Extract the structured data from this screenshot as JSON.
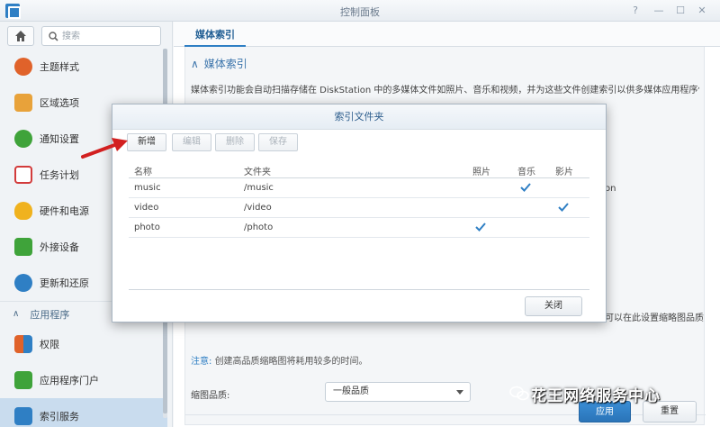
{
  "window": {
    "title": "控制面板"
  },
  "search": {
    "placeholder": "搜索"
  },
  "sidebar": {
    "items": [
      {
        "label": "主题样式",
        "icon": "palette-icon",
        "color": "#e0622a"
      },
      {
        "label": "区域选项",
        "icon": "region-icon",
        "color": "#e8a23a"
      },
      {
        "label": "通知设置",
        "icon": "chat-bubble-icon",
        "color": "#3fa33a"
      },
      {
        "label": "任务计划",
        "icon": "calendar-check-icon",
        "color": "#d23b3b"
      },
      {
        "label": "硬件和电源",
        "icon": "bulb-icon",
        "color": "#f0b21e"
      },
      {
        "label": "外接设备",
        "icon": "upload-icon",
        "color": "#3fa33a"
      },
      {
        "label": "更新和还原",
        "icon": "refresh-icon",
        "color": "#2f7fc4"
      }
    ],
    "section_label": "应用程序",
    "app_items": [
      {
        "label": "权限",
        "icon": "grid-icon",
        "color": "#e0622a"
      },
      {
        "label": "应用程序门户",
        "icon": "portal-icon",
        "color": "#3fa33a"
      },
      {
        "label": "索引服务",
        "icon": "index-search-icon",
        "color": "#2f7fc4"
      }
    ]
  },
  "main": {
    "tab": "媒体索引",
    "section_title": "媒体索引",
    "description": "媒体索引功能会自动扫描存储在 DiskStation 中的多媒体文件如照片、音乐和视频，并为这些文件创建索引以供多媒体应用程序使用。",
    "peek_right_1": "on",
    "peek_right_2": "可以在此设置缩略图品质",
    "note_label": "注意:",
    "note_text": "创建高品质缩略图将耗用较多的时间。",
    "quality_label": "缩图品质:",
    "quality_value": "一般品质",
    "apply": "应用",
    "reset": "重置"
  },
  "modal": {
    "title": "索引文件夹",
    "buttons": {
      "add": "新增",
      "edit": "编辑",
      "delete": "删除",
      "save": "保存"
    },
    "columns": {
      "name": "名称",
      "folder": "文件夹",
      "photo": "照片",
      "music": "音乐",
      "video": "影片"
    },
    "rows": [
      {
        "name": "music",
        "folder": "/music",
        "photo": false,
        "music": true,
        "video": false
      },
      {
        "name": "video",
        "folder": "/video",
        "photo": false,
        "music": false,
        "video": true
      },
      {
        "name": "photo",
        "folder": "/photo",
        "photo": true,
        "music": false,
        "video": false
      }
    ],
    "close": "关闭"
  },
  "watermark": "花王网络服务中心",
  "colors": {
    "accent": "#2f7fc4",
    "annotation_arrow": "#d22020"
  }
}
